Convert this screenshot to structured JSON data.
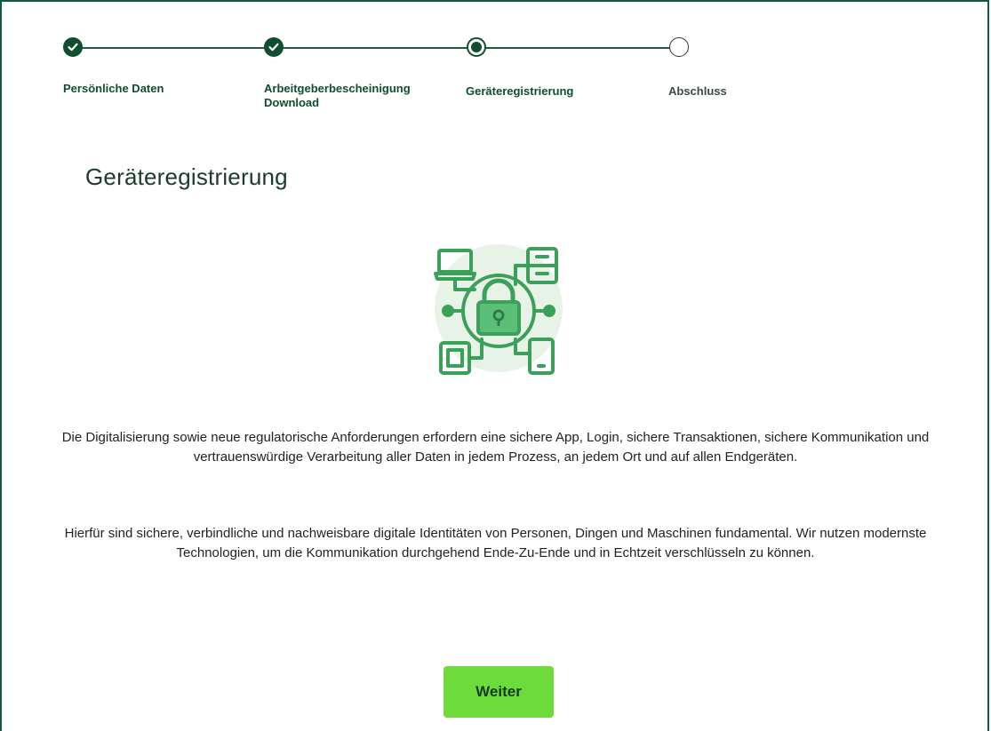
{
  "stepper": {
    "steps": [
      {
        "label": "Persönliche Daten",
        "state": "done"
      },
      {
        "label": "Arbeitgeberbescheinigung Download",
        "state": "done"
      },
      {
        "label": "Geräteregistrierung",
        "state": "current"
      },
      {
        "label": "Abschluss",
        "state": "todo"
      }
    ]
  },
  "page": {
    "title": "Geräteregistrierung",
    "illustration_icon": "device-security-network-icon",
    "paragraph1": "Die Digitalisierung sowie neue regulatorische Anforderungen erfordern eine sichere App, Login, sichere Transaktionen, sichere Kommunikation und vertrauenswürdige Verarbeitung aller Daten in jedem Prozess, an jedem Ort und auf allen Endgeräten.",
    "paragraph2": "Hierfür sind sichere, verbindliche und nachweisbare digitale Identitäten von Personen, Dingen und Maschinen fundamental. Wir nutzen modernste Technologien, um die Kommunikation durchgehend Ende-Zu-Ende und in Echtzeit verschlüsseln zu können.",
    "next_button_label": "Weiter"
  },
  "colors": {
    "brand_dark_green": "#0f4e2f",
    "button_green": "#6ddb3a",
    "illustration_green": "#3aa05a",
    "illustration_bg": "#e6f3e6"
  }
}
